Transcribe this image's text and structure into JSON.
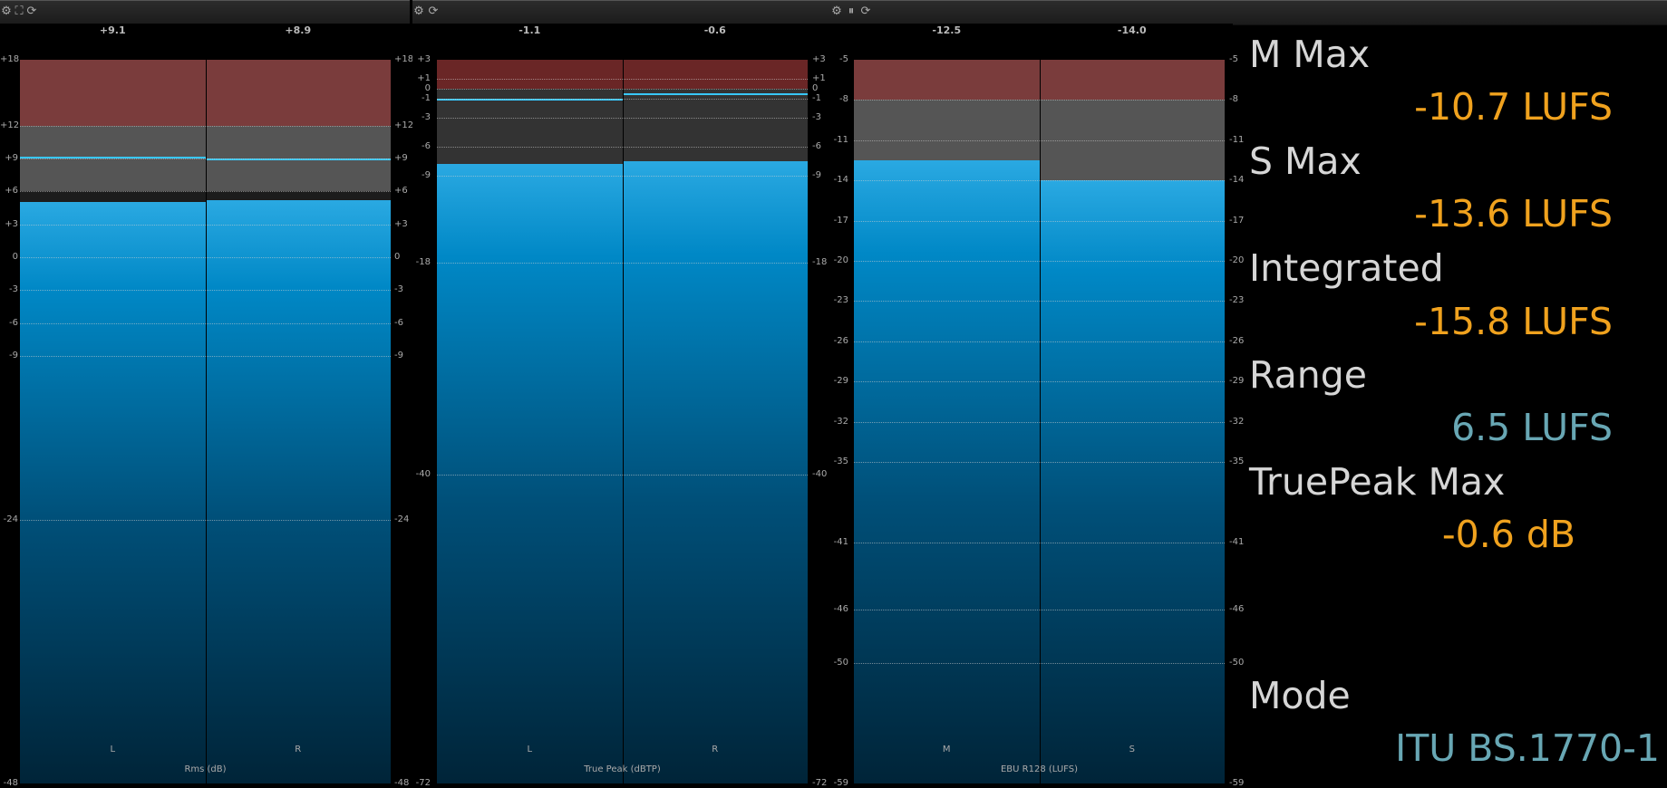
{
  "colors": {
    "value_orange": "#f0a21e",
    "value_teal": "#68a7b4",
    "label": "#d6d6d6",
    "over_red": "#7a3c3c",
    "over_red_dark": "#6a2626",
    "warn_grey": "#555555",
    "bg": "#000000",
    "hold_line": "#38c8ff"
  },
  "toolbars": [
    {
      "icons": [
        "gear-icon",
        "fullscreen-icon",
        "refresh-icon"
      ]
    },
    {
      "icons": [
        "gear-icon",
        "refresh-icon"
      ]
    },
    {
      "icons": [
        "gear-icon",
        "pause-icon",
        "refresh-icon"
      ]
    }
  ],
  "meters": [
    {
      "caption": "Rms (dB)",
      "scale": {
        "min": -48,
        "max": 18
      },
      "red_from": 12,
      "grey_from": 6,
      "ticks": [
        "+18",
        "+12",
        "+9",
        "+6",
        "+3",
        "0",
        "-3",
        "-6",
        "-9",
        "-24",
        "-48"
      ],
      "tick_values": [
        18,
        12,
        9,
        6,
        3,
        0,
        -3,
        -6,
        -9,
        -24,
        -48
      ],
      "grid": [
        12,
        9,
        6,
        3,
        0,
        -3,
        -6,
        -9,
        -24
      ],
      "channels": [
        {
          "label": "L",
          "peak": "+9.1",
          "level": 5.0,
          "hold": 9.1
        },
        {
          "label": "R",
          "peak": "+8.9",
          "level": 5.2,
          "hold": 8.9
        }
      ]
    },
    {
      "caption": "True Peak (dBTP)",
      "scale": {
        "min": -72,
        "max": 3
      },
      "red_from": 0,
      "grey_from": -9,
      "ticks": [
        "+3",
        "+1",
        "0",
        "-1",
        "-3",
        "-6",
        "-9",
        "-18",
        "-40",
        "-72"
      ],
      "tick_values": [
        3,
        1,
        0,
        -1,
        -3,
        -6,
        -9,
        -18,
        -40,
        -72
      ],
      "grid": [
        1,
        0,
        -1,
        -3,
        -6,
        -9,
        -18,
        -40
      ],
      "channels": [
        {
          "label": "L",
          "peak": "-1.1",
          "level": -7.8,
          "hold": -1.1
        },
        {
          "label": "R",
          "peak": "-0.6",
          "level": -7.5,
          "hold": -0.6
        }
      ]
    },
    {
      "caption": "EBU R128 (LUFS)",
      "scale": {
        "min": -59,
        "max": -5
      },
      "red_from": -8,
      "grey_from": -14,
      "ticks": [
        "-5",
        "-8",
        "-11",
        "-14",
        "-17",
        "-20",
        "-23",
        "-26",
        "-29",
        "-32",
        "-35",
        "-41",
        "-46",
        "-50",
        "-59"
      ],
      "tick_values": [
        -5,
        -8,
        -11,
        -14,
        -17,
        -20,
        -23,
        -26,
        -29,
        -32,
        -35,
        -41,
        -46,
        -50,
        -59
      ],
      "grid": [
        -8,
        -11,
        -14,
        -17,
        -20,
        -23,
        -26,
        -29,
        -32,
        -35,
        -41,
        -46,
        -50
      ],
      "channels": [
        {
          "label": "M",
          "peak": "-12.5",
          "level": -12.5,
          "hold": null
        },
        {
          "label": "S",
          "peak": "-14.0",
          "level": -14.0,
          "hold": null
        }
      ]
    }
  ],
  "panel": {
    "m_max": {
      "label": "M Max",
      "value": "-10.7 LUFS"
    },
    "s_max": {
      "label": "S Max",
      "value": "-13.6 LUFS"
    },
    "integrated": {
      "label": "Integrated",
      "value": "-15.8 LUFS"
    },
    "range": {
      "label": "Range",
      "value": "6.5 LUFS"
    },
    "truepeak": {
      "label": "TruePeak Max",
      "value": "-0.6 dB"
    },
    "mode": {
      "label": "Mode",
      "value": "ITU BS.1770-1"
    }
  }
}
